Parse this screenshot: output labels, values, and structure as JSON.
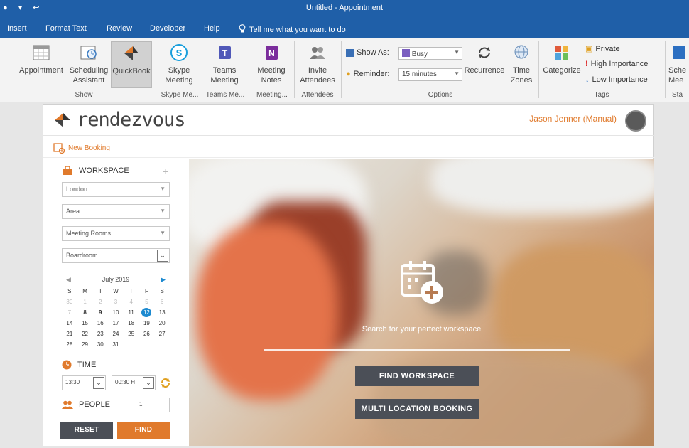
{
  "window": {
    "title": "Untitled  -  Appointment"
  },
  "menu": {
    "items": [
      "Insert",
      "Format Text",
      "Review",
      "Developer",
      "Help"
    ],
    "tell_me": "Tell me what you want to do"
  },
  "ribbon": {
    "show": {
      "buttons": [
        {
          "l1": "Appointment",
          "l2": ""
        },
        {
          "l1": "Scheduling",
          "l2": "Assistant"
        },
        {
          "l1": "QuickBook",
          "l2": ""
        }
      ],
      "group": "Show"
    },
    "skype": {
      "l1": "Skype",
      "l2": "Meeting",
      "group": "Skype Me..."
    },
    "teams": {
      "l1": "Teams",
      "l2": "Meeting",
      "group": "Teams Me..."
    },
    "notes": {
      "l1": "Meeting",
      "l2": "Notes",
      "group": "Meeting..."
    },
    "attendees": {
      "l1": "Invite",
      "l2": "Attendees",
      "group": "Attendees"
    },
    "options": {
      "show_as_label": "Show As:",
      "show_as_value": "Busy",
      "reminder_label": "Reminder:",
      "reminder_value": "15 minutes",
      "recurrence": "Recurrence",
      "time_zones_l1": "Time",
      "time_zones_l2": "Zones",
      "group": "Options"
    },
    "tags": {
      "categorize": "Categorize",
      "private": "Private",
      "high": "High Importance",
      "low": "Low Importance",
      "group": "Tags"
    },
    "sched": {
      "l1": "Sche",
      "l2": "Mee",
      "group": "Sta"
    }
  },
  "app": {
    "brand": "rendezvous",
    "user": "Jason Jenner (Manual)",
    "new_booking": "New Booking",
    "workspace": {
      "title": "WORKSPACE",
      "add": "+",
      "location": "London",
      "area": "Area",
      "type": "Meeting Rooms",
      "room": "Boardroom"
    },
    "calendar": {
      "month": "July 2019",
      "weekdays": [
        "S",
        "M",
        "T",
        "W",
        "T",
        "F",
        "S"
      ],
      "weeks": [
        [
          "30",
          "1",
          "2",
          "3",
          "4",
          "5",
          "6"
        ],
        [
          "7",
          "8",
          "9",
          "10",
          "11",
          "12",
          "13"
        ],
        [
          "14",
          "15",
          "16",
          "17",
          "18",
          "19",
          "20"
        ],
        [
          "21",
          "22",
          "23",
          "24",
          "25",
          "26",
          "27"
        ],
        [
          "28",
          "29",
          "30",
          "31",
          "",
          "",
          ""
        ]
      ],
      "selected": "12"
    },
    "time": {
      "title": "TIME",
      "start": "13:30",
      "duration": "00:30 H"
    },
    "people": {
      "title": "PEOPLE",
      "value": "1"
    },
    "reset": "RESET",
    "find": "FIND",
    "hero": {
      "text": "Search for your perfect workspace",
      "find_workspace": "FIND WORKSPACE",
      "multi": "MULTI LOCATION BOOKING"
    }
  },
  "colors": {
    "accent": "#e07a2c",
    "office_blue": "#1f5fa8",
    "selected_day": "#1d8ad0",
    "dark_button": "#4b4f57"
  }
}
